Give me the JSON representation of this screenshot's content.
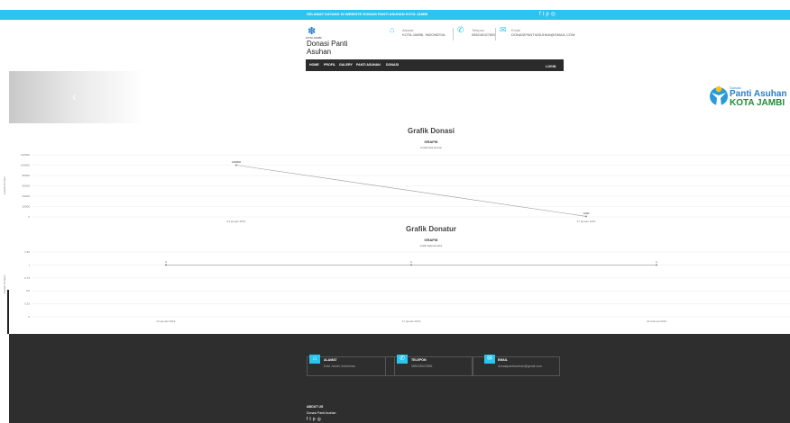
{
  "topbar": {
    "message": "SELAMAT DATANG DI WEBSITE DONASI PANTI ASUHAN KOTA JAMBI",
    "social_icons": [
      "facebook-icon",
      "twitter-icon",
      "pinterest-icon",
      "instagram-icon"
    ]
  },
  "header": {
    "logo_subtext": "KOTA JAMBI",
    "logo_title": "Donasi Panti Asuhan",
    "alamat_label": "Alamat",
    "alamat_value": "KOTA JAMBI, INDONESIA",
    "telepon_label": "Telepon",
    "telepon_value": "085245327859",
    "email_label": "Email",
    "email_value": "DONASIPANTIASUHAN@GMAIL.COM"
  },
  "nav": {
    "items": [
      "HOME",
      "PROFIL",
      "GALERY",
      "PANTI ASUHAN",
      "DONASI"
    ],
    "login": "LOGIN"
  },
  "slider": {
    "brand_small": "Donasi",
    "brand_line1": "Panti Asuhan",
    "brand_line2": "KOTA JAMBI"
  },
  "sections": {
    "donasi_title": "Grafik Donasi",
    "donatur_title": "Grafik Donatur"
  },
  "chart_data": [
    {
      "type": "line",
      "title": "GRAFIK",
      "subtitle": "Grafik Data Donasi",
      "ylabel": "Jumlah Donasi",
      "x": [
        "01 januari 2019",
        "27 januari 2019"
      ],
      "series": [
        {
          "values": [
            100000,
            1000
          ]
        }
      ],
      "data_labels": [
        "100000",
        "1000"
      ],
      "yticks": [
        "0",
        "20000",
        "40000",
        "60000",
        "80000",
        "100000",
        "120000"
      ],
      "ylim": [
        0,
        120000
      ],
      "grid": true
    },
    {
      "type": "line",
      "title": "GRAFIK",
      "subtitle": "Grafik Data Donatur",
      "ylabel": "Jumlah Donatur",
      "x": [
        "01 januari 2019",
        "27 januari 2019",
        "04 februari 2019"
      ],
      "series": [
        {
          "values": [
            1,
            1,
            1
          ]
        }
      ],
      "data_labels": [
        "1",
        "1",
        "1"
      ],
      "yticks": [
        "0",
        "0.25",
        "0.5",
        "0.75",
        "1",
        "1.25"
      ],
      "ylim": [
        0,
        1.25
      ],
      "grid": true
    }
  ],
  "footer": {
    "alamat_title": "ALAMAT",
    "alamat_value": "Kota Jambi, Indonesia",
    "telepon_title": "TELEPON",
    "telepon_value": "085245327859",
    "email_title": "EMAIL",
    "email_value": "donasipantiasuhan@gmail.com",
    "about_title": "ABOUT US",
    "about_text": "Donasi Panti Asuhan"
  }
}
